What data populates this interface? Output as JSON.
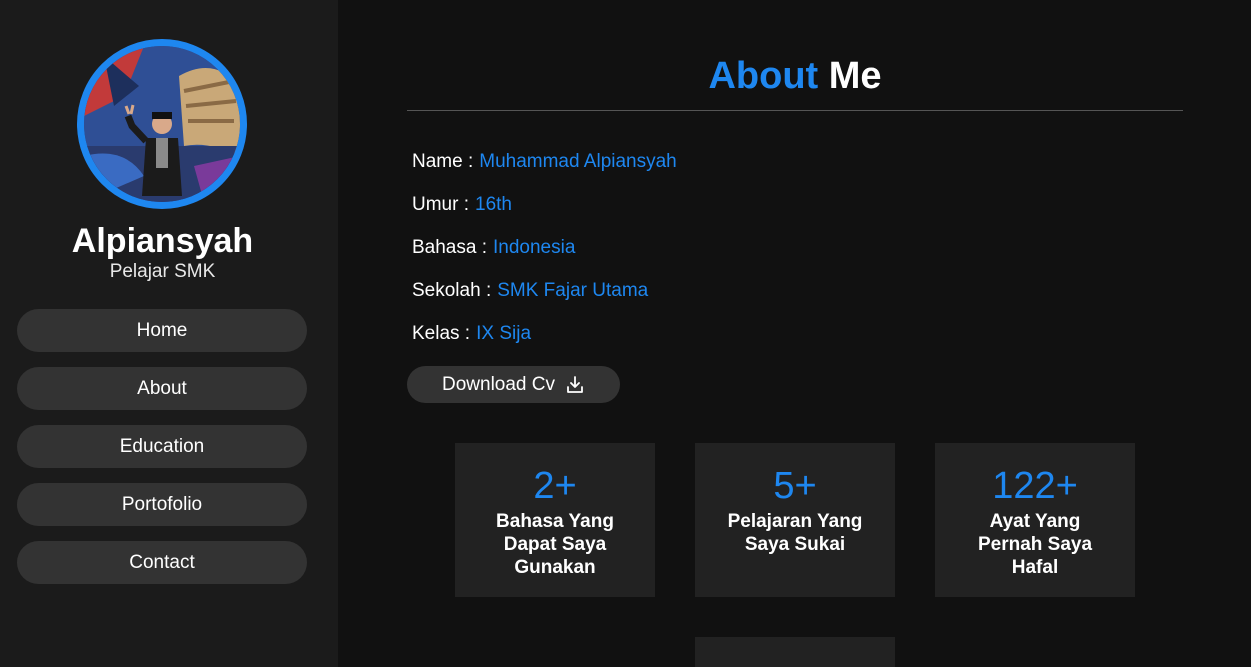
{
  "profile": {
    "name": "Alpiansyah",
    "role": "Pelajar SMK",
    "avatar_icon": "profile-photo"
  },
  "nav": [
    {
      "label": "Home"
    },
    {
      "label": "About"
    },
    {
      "label": "Education"
    },
    {
      "label": "Portofolio"
    },
    {
      "label": "Contact"
    }
  ],
  "about": {
    "title_accent": "About",
    "title_rest": "Me",
    "info": [
      {
        "label": "Name :",
        "value": "Muhammad Alpiansyah"
      },
      {
        "label": "Umur :",
        "value": "16th"
      },
      {
        "label": "Bahasa :",
        "value": "Indonesia"
      },
      {
        "label": "Sekolah :",
        "value": "SMK Fajar Utama"
      },
      {
        "label": "Kelas :",
        "value": "IX Sija"
      }
    ],
    "cv_button": "Download Cv",
    "cv_icon": "download-icon"
  },
  "stats": [
    {
      "number": "2+",
      "label": "Bahasa Yang Dapat Saya Gunakan"
    },
    {
      "number": "5+",
      "label": "Pelajaran Yang Saya Sukai"
    },
    {
      "number": "122+",
      "label": "Ayat Yang Pernah Saya Hafal"
    }
  ],
  "colors": {
    "accent": "#1e87f0",
    "background": "#111111",
    "sidebar": "#1b1b1b",
    "button": "#333333",
    "card": "#222222"
  }
}
